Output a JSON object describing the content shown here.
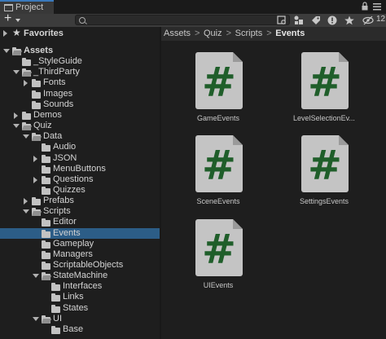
{
  "window": {
    "tab_title": "Project",
    "hidden_count": "12"
  },
  "search": {
    "placeholder": "",
    "value": ""
  },
  "favorites": {
    "label": "Favorites"
  },
  "tree": [
    {
      "label": "Assets",
      "depth": 0,
      "expanded": true,
      "has_children": true,
      "bold": true
    },
    {
      "label": "_StyleGuide",
      "depth": 1,
      "expanded": false,
      "has_children": false
    },
    {
      "label": "_ThirdParty",
      "depth": 1,
      "expanded": true,
      "has_children": true
    },
    {
      "label": "Fonts",
      "depth": 2,
      "expanded": false,
      "has_children": true
    },
    {
      "label": "Images",
      "depth": 2,
      "expanded": false,
      "has_children": false
    },
    {
      "label": "Sounds",
      "depth": 2,
      "expanded": false,
      "has_children": false
    },
    {
      "label": "Demos",
      "depth": 1,
      "expanded": false,
      "has_children": true
    },
    {
      "label": "Quiz",
      "depth": 1,
      "expanded": true,
      "has_children": true
    },
    {
      "label": "Data",
      "depth": 2,
      "expanded": true,
      "has_children": true
    },
    {
      "label": "Audio",
      "depth": 3,
      "expanded": false,
      "has_children": false
    },
    {
      "label": "JSON",
      "depth": 3,
      "expanded": false,
      "has_children": true
    },
    {
      "label": "MenuButtons",
      "depth": 3,
      "expanded": false,
      "has_children": false
    },
    {
      "label": "Questions",
      "depth": 3,
      "expanded": false,
      "has_children": true
    },
    {
      "label": "Quizzes",
      "depth": 3,
      "expanded": false,
      "has_children": false
    },
    {
      "label": "Prefabs",
      "depth": 2,
      "expanded": false,
      "has_children": true
    },
    {
      "label": "Scripts",
      "depth": 2,
      "expanded": true,
      "has_children": true
    },
    {
      "label": "Editor",
      "depth": 3,
      "expanded": false,
      "has_children": false
    },
    {
      "label": "Events",
      "depth": 3,
      "expanded": false,
      "has_children": false,
      "selected": true
    },
    {
      "label": "Gameplay",
      "depth": 3,
      "expanded": false,
      "has_children": false
    },
    {
      "label": "Managers",
      "depth": 3,
      "expanded": false,
      "has_children": false
    },
    {
      "label": "ScriptableObjects",
      "depth": 3,
      "expanded": false,
      "has_children": false
    },
    {
      "label": "StateMachine",
      "depth": 3,
      "expanded": true,
      "has_children": true
    },
    {
      "label": "Interfaces",
      "depth": 4,
      "expanded": false,
      "has_children": false
    },
    {
      "label": "Links",
      "depth": 4,
      "expanded": false,
      "has_children": false
    },
    {
      "label": "States",
      "depth": 4,
      "expanded": false,
      "has_children": false
    },
    {
      "label": "UI",
      "depth": 3,
      "expanded": true,
      "has_children": true
    },
    {
      "label": "Base",
      "depth": 4,
      "expanded": false,
      "has_children": false
    }
  ],
  "breadcrumb": [
    "Assets",
    "Quiz",
    "Scripts",
    "Events"
  ],
  "breadcrumb_separator": ">",
  "assets": [
    {
      "name": "GameEvents",
      "icon": "csharp-script-icon"
    },
    {
      "name": "LevelSelectionEv...",
      "icon": "csharp-script-icon"
    },
    {
      "name": "SceneEvents",
      "icon": "csharp-script-icon"
    },
    {
      "name": "SettingsEvents",
      "icon": "csharp-script-icon"
    },
    {
      "name": "UIEvents",
      "icon": "csharp-script-icon"
    }
  ],
  "script_glyph": "#",
  "colors": {
    "selection": "#2c5d87",
    "script_page": "#c4c4c4",
    "script_hash": "#1f5e2a",
    "tab_accent": "#3a79bb"
  },
  "toolbar_icons": [
    "add-icon",
    "search-icon",
    "search-by-type-icon",
    "search-by-label-icon",
    "warning-icon",
    "favorite-star-icon",
    "hidden-packages-icon"
  ]
}
